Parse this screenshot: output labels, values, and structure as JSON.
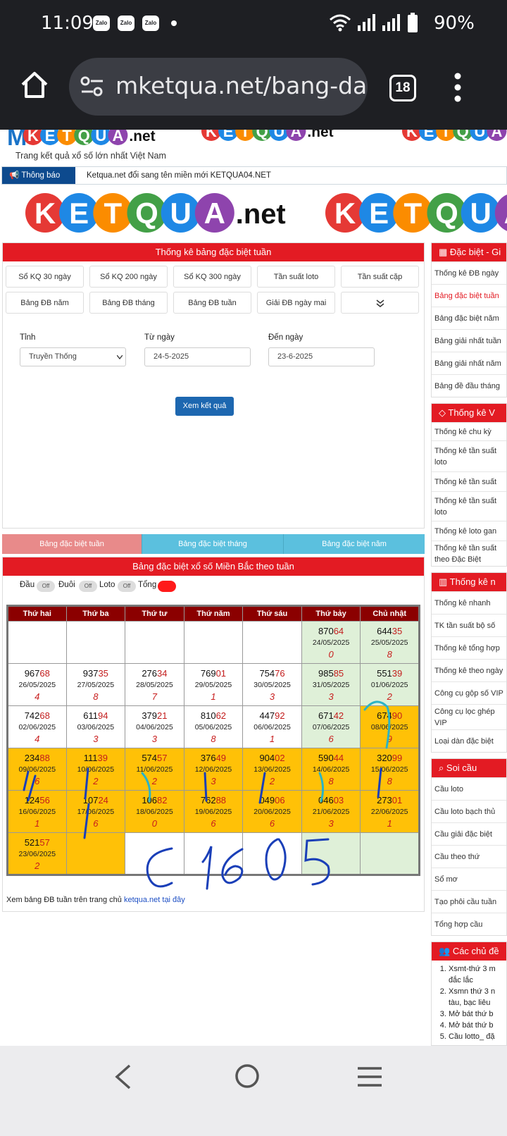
{
  "status_bar": {
    "time": "11:09",
    "notifications": [
      "Zalo",
      "Zalo",
      "Zalo"
    ],
    "battery": "90%"
  },
  "browser": {
    "url": "mketqua.net/bang-dac",
    "tab_count": "18"
  },
  "site": {
    "logo_prefix": "M",
    "logo_letters": [
      "K",
      "E",
      "T",
      "Q",
      "U",
      "A"
    ],
    "logo_suffix": ".net",
    "tagline": "Trang kết quả xổ số lớn nhất Việt Nam",
    "notice_label": "Thông báo",
    "notice_text": "Ketqua.net đổi sang tên miền mới KETQUA04.NET"
  },
  "stats_panel": {
    "title": "Thống kê bảng đặc biệt tuần",
    "buttons": [
      "Sổ KQ 30 ngày",
      "Sổ KQ 200 ngày",
      "Sổ KQ 300 ngày",
      "Tần suất loto",
      "Tần suất cặp",
      "Bảng ĐB năm",
      "Bảng ĐB tháng",
      "Bảng ĐB tuần",
      "Giải ĐB ngày mai"
    ],
    "tinh_label": "Tỉnh",
    "tinh_value": "Truyền Thống",
    "from_label": "Từ ngày",
    "from_value": "24-5-2025",
    "to_label": "Đến ngày",
    "to_value": "23-6-2025",
    "submit": "Xem kết quả"
  },
  "tabs": [
    "Bảng đặc biệt tuần",
    "Bảng đặc biệt tháng",
    "Bảng đặc biệt năm"
  ],
  "colors": {
    "red": "#e31b23",
    "tab_active": "#e88a8a",
    "tab": "#5bc0de",
    "yellow": "#ffc107",
    "green": "#dff0d8",
    "header": "#8b0000"
  },
  "table": {
    "title": "Bảng đặc biệt xổ số Miền Bắc theo tuần",
    "toggles": [
      {
        "label": "Đầu",
        "state": "Off"
      },
      {
        "label": "Đuôi",
        "state": "Off"
      },
      {
        "label": "Loto",
        "state": "Off"
      },
      {
        "label": "Tổng",
        "state": "On"
      }
    ],
    "headers": [
      "Thứ hai",
      "Thứ ba",
      "Thứ tư",
      "Thứ năm",
      "Thứ sáu",
      "Thứ bảy",
      "Chủ nhật"
    ],
    "rows": [
      [
        {
          "bg": "w"
        },
        {
          "bg": "w"
        },
        {
          "bg": "w"
        },
        {
          "bg": "w"
        },
        {
          "bg": "w"
        },
        {
          "bg": "g",
          "head": "870",
          "tail": "64",
          "date": "24/05/2025",
          "total": "0"
        },
        {
          "bg": "g",
          "head": "644",
          "tail": "35",
          "date": "25/05/2025",
          "total": "8"
        }
      ],
      [
        {
          "bg": "w",
          "head": "967",
          "tail": "68",
          "date": "26/05/2025",
          "total": "4"
        },
        {
          "bg": "w",
          "head": "937",
          "tail": "35",
          "date": "27/05/2025",
          "total": "8"
        },
        {
          "bg": "w",
          "head": "276",
          "tail": "34",
          "date": "28/05/2025",
          "total": "7"
        },
        {
          "bg": "w",
          "head": "769",
          "tail": "01",
          "date": "29/05/2025",
          "total": "1"
        },
        {
          "bg": "w",
          "head": "754",
          "tail": "76",
          "date": "30/05/2025",
          "total": "3"
        },
        {
          "bg": "g",
          "head": "985",
          "tail": "85",
          "date": "31/05/2025",
          "total": "3"
        },
        {
          "bg": "g",
          "head": "551",
          "tail": "39",
          "date": "01/06/2025",
          "total": "2"
        }
      ],
      [
        {
          "bg": "w",
          "head": "742",
          "tail": "68",
          "date": "02/06/2025",
          "total": "4"
        },
        {
          "bg": "w",
          "head": "611",
          "tail": "94",
          "date": "03/06/2025",
          "total": "3"
        },
        {
          "bg": "w",
          "head": "379",
          "tail": "21",
          "date": "04/06/2025",
          "total": "3"
        },
        {
          "bg": "w",
          "head": "810",
          "tail": "62",
          "date": "05/06/2025",
          "total": "8"
        },
        {
          "bg": "w",
          "head": "447",
          "tail": "92",
          "date": "06/06/2025",
          "total": "1"
        },
        {
          "bg": "g",
          "head": "671",
          "tail": "42",
          "date": "07/06/2025",
          "total": "6"
        },
        {
          "bg": "y",
          "head": "674",
          "tail": "90",
          "date": "08/06/2025",
          "total": "9"
        }
      ],
      [
        {
          "bg": "y",
          "head": "234",
          "tail": "88",
          "date": "09/06/2025",
          "total": "6"
        },
        {
          "bg": "y",
          "head": "111",
          "tail": "39",
          "date": "10/06/2025",
          "total": "2"
        },
        {
          "bg": "y",
          "head": "574",
          "tail": "57",
          "date": "11/06/2025",
          "total": "2"
        },
        {
          "bg": "y",
          "head": "376",
          "tail": "49",
          "date": "12/06/2025",
          "total": "3"
        },
        {
          "bg": "y",
          "head": "904",
          "tail": "02",
          "date": "13/06/2025",
          "total": "2"
        },
        {
          "bg": "y",
          "head": "590",
          "tail": "44",
          "date": "14/06/2025",
          "total": "8"
        },
        {
          "bg": "y",
          "head": "320",
          "tail": "99",
          "date": "15/06/2025",
          "total": "8"
        }
      ],
      [
        {
          "bg": "y",
          "head": "124",
          "tail": "56",
          "date": "16/06/2025",
          "total": "1"
        },
        {
          "bg": "y",
          "head": "107",
          "tail": "24",
          "date": "17/06/2025",
          "total": "6"
        },
        {
          "bg": "y",
          "head": "106",
          "tail": "82",
          "date": "18/06/2025",
          "total": "0"
        },
        {
          "bg": "y",
          "head": "762",
          "tail": "88",
          "date": "19/06/2025",
          "total": "6"
        },
        {
          "bg": "y",
          "head": "049",
          "tail": "06",
          "date": "20/06/2025",
          "total": "6"
        },
        {
          "bg": "y",
          "head": "046",
          "tail": "03",
          "date": "21/06/2025",
          "total": "3"
        },
        {
          "bg": "y",
          "head": "273",
          "tail": "01",
          "date": "22/06/2025",
          "total": "1"
        }
      ],
      [
        {
          "bg": "y",
          "head": "521",
          "tail": "57",
          "date": "23/06/2025",
          "total": "2"
        },
        {
          "bg": "y"
        },
        {
          "bg": "w"
        },
        {
          "bg": "w"
        },
        {
          "bg": "w"
        },
        {
          "bg": "g"
        },
        {
          "bg": "g"
        }
      ]
    ],
    "footnote_text": "Xem bảng ĐB tuần trên trang chủ",
    "footnote_link": "ketqua.net tại đây"
  },
  "sidebar": {
    "sections": [
      {
        "title": "Đặc biệt - Gi",
        "icon": "table-icon",
        "items": [
          {
            "label": "Thống kê ĐB ngày",
            "h": 32
          },
          {
            "label": "Bảng đặc biệt tuần",
            "h": 32,
            "active": true
          },
          {
            "label": "Bảng đặc biệt năm",
            "h": 32
          },
          {
            "label": "Bảng giải nhất tuần",
            "h": 32
          },
          {
            "label": "Bảng giải nhất năm",
            "h": 32
          },
          {
            "label": "Bảng đề đầu tháng",
            "h": 32
          }
        ]
      },
      {
        "title": "Thống kê V",
        "icon": "diamond-icon",
        "items": [
          {
            "label": "Thống kê chu kỳ",
            "h": 26
          },
          {
            "label": "Thống kê tần suất loto",
            "h": 44,
            "wrap": true
          },
          {
            "label": "Thống kê tần suất",
            "h": 28
          },
          {
            "label": "Thống kê tần suất loto",
            "h": 42,
            "wrap": true
          },
          {
            "label": "Thống kê loto gan",
            "h": 28
          },
          {
            "label": "Thống kê tần suất theo Đặc Biệt",
            "h": 36,
            "wrap": true
          }
        ]
      },
      {
        "title": "Thống kê n",
        "icon": "bar-chart-icon",
        "items": [
          {
            "label": "Thống kê nhanh",
            "h": 32
          },
          {
            "label": "TK tần suất bộ số",
            "h": 32
          },
          {
            "label": "Thống kê tổng hợp",
            "h": 32
          },
          {
            "label": "Thống kê theo ngày",
            "h": 32
          },
          {
            "label": "Công cụ gộp số VIP",
            "h": 32
          },
          {
            "label": "Công cụ lọc ghép VIP",
            "h": 36,
            "wrap": true
          },
          {
            "label": "Loại dàn đặc biệt",
            "h": 32
          }
        ]
      },
      {
        "title": "Soi cầu",
        "icon": "search-icon",
        "items": [
          {
            "label": "Cầu loto",
            "h": 32
          },
          {
            "label": "Cầu loto bạch thủ",
            "h": 32
          },
          {
            "label": "Cầu giải đặc biệt",
            "h": 32
          },
          {
            "label": "Cầu theo thứ",
            "h": 32
          },
          {
            "label": "Sổ mơ",
            "h": 32
          },
          {
            "label": "Tạo phôi cầu tuần",
            "h": 32
          },
          {
            "label": "Tổng hợp cầu",
            "h": 32
          }
        ]
      },
      {
        "title": "Các chủ đề",
        "icon": "users-icon",
        "list": [
          "Xsmt-thứ 3 m đắc lắc",
          "Xsmn thứ 3 n tàu, bạc liêu",
          "Mở bát thứ b",
          "Mở bát thứ b",
          "Cầu lotto_ đặ"
        ]
      }
    ]
  }
}
